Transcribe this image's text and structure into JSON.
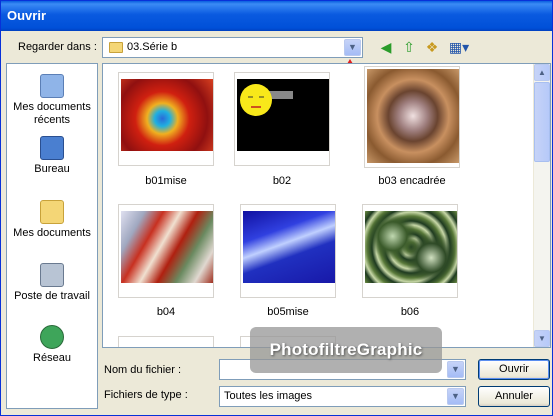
{
  "window": {
    "title": "Ouvrir"
  },
  "lookin": {
    "label": "Regarder dans :",
    "value": "03.Série b"
  },
  "places": [
    {
      "label": "Mes documents récents",
      "icon": "recent-documents-icon"
    },
    {
      "label": "Bureau",
      "icon": "desktop-icon"
    },
    {
      "label": "Mes documents",
      "icon": "my-documents-icon"
    },
    {
      "label": "Poste de travail",
      "icon": "my-computer-icon"
    },
    {
      "label": "Réseau",
      "icon": "network-icon"
    }
  ],
  "files": [
    {
      "name": "b01mise"
    },
    {
      "name": "b02"
    },
    {
      "name": "b03 encadrée"
    },
    {
      "name": "b04"
    },
    {
      "name": "b05mise"
    },
    {
      "name": "b06"
    }
  ],
  "filename": {
    "label": "Nom du fichier :",
    "value": ""
  },
  "filetype": {
    "label": "Fichiers de type :",
    "value": "Toutes les images"
  },
  "buttons": {
    "open": "Ouvrir",
    "cancel": "Annuler"
  },
  "watermark": "PhotofiltreGraphic",
  "colors": {
    "titlebar": "#0a5ae0",
    "dialog": "#ece9d8",
    "highlight_arrow": "#e02020"
  }
}
